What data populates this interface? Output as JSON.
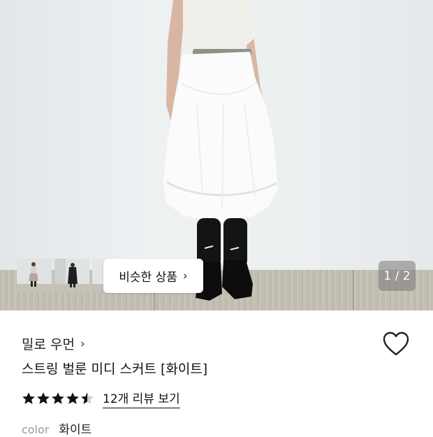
{
  "product_image": {
    "thumbnails": [
      "thumbnail-1",
      "thumbnail-2",
      "thumbnail-3"
    ],
    "similar_button": {
      "label": "비슷한 상품",
      "chevron": "›"
    },
    "pager": "1 / 2"
  },
  "brand": {
    "name": "밀로 우먼",
    "chevron": "›"
  },
  "product": {
    "title": "스트링 벌룬 미디 스커트 [화이트]"
  },
  "rating": {
    "value": 4.5,
    "max": 5,
    "review_link": "12개 리뷰 보기"
  },
  "option": {
    "label": "color",
    "value": "화이트"
  },
  "icons": {
    "wishlist": "heart-outline-icon",
    "star": "star-icon"
  },
  "colors": {
    "star": "#111111",
    "star_empty": "#cccccc",
    "pager_bg": "#7a7a7a"
  }
}
